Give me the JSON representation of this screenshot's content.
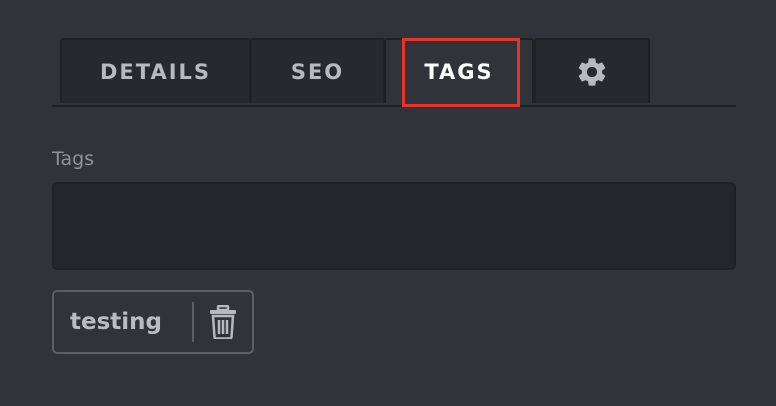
{
  "tabs": [
    {
      "label": "DETAILS"
    },
    {
      "label": "SEO"
    },
    {
      "label": "TAGS",
      "active": true
    },
    {
      "icon": "gear-icon"
    }
  ],
  "tags_field": {
    "label": "Tags",
    "value": ""
  },
  "tags": [
    {
      "label": "testing",
      "remove_icon": "trash-icon"
    }
  ],
  "colors": {
    "background": "#30333a",
    "highlight": "#e5352a"
  }
}
